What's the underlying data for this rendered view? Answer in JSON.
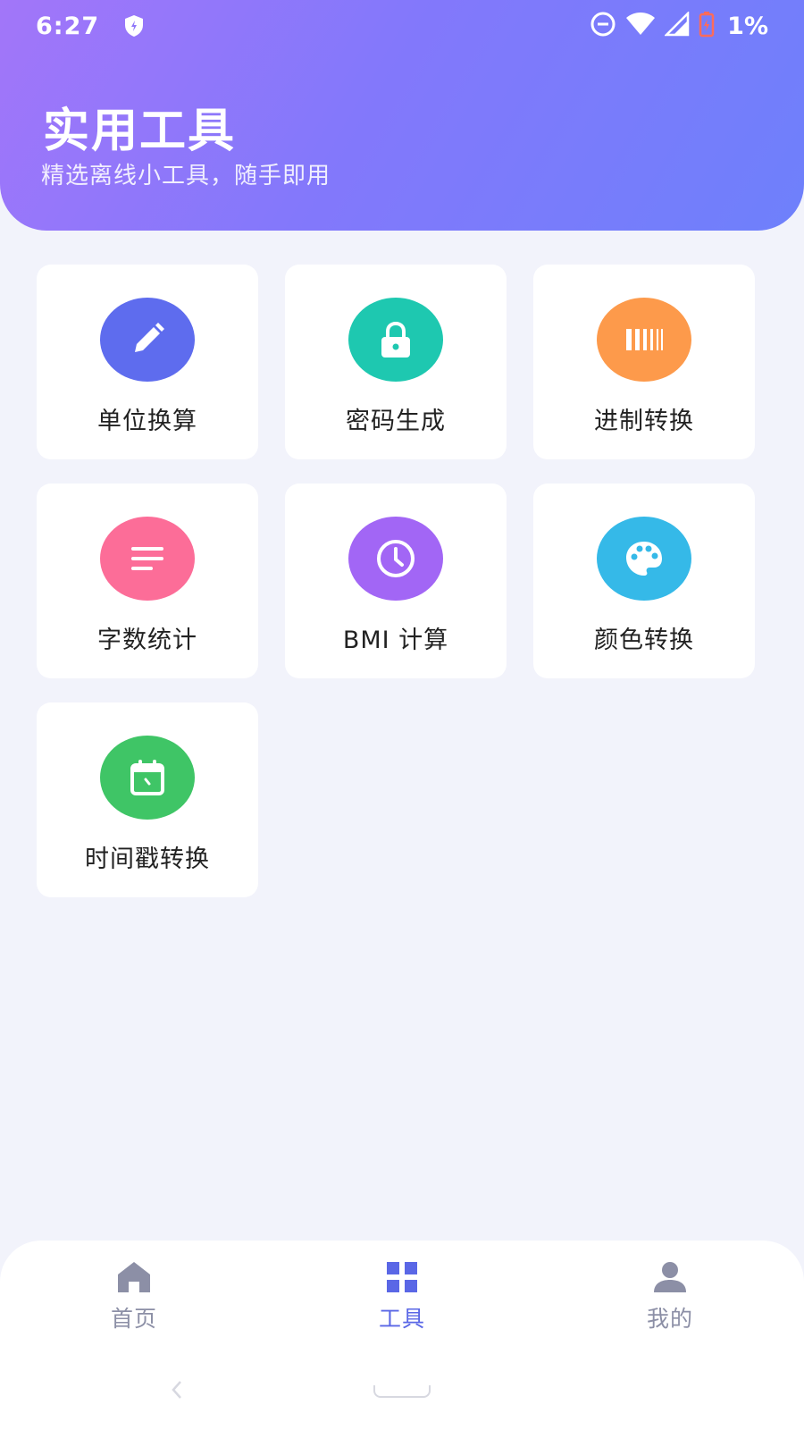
{
  "status_bar": {
    "time": "6:27",
    "battery": "1%",
    "icons": [
      "shield-icon",
      "dnd-icon",
      "wifi-icon",
      "signal-icon",
      "battery-icon"
    ]
  },
  "header": {
    "title": "实用工具",
    "subtitle": "精选离线小工具，随手即用",
    "gradient": [
      "#a276f9",
      "#6e80fb"
    ]
  },
  "tools": [
    {
      "label": "单位换算",
      "icon": "pencil-icon",
      "color": "#5e6cee"
    },
    {
      "label": "密码生成",
      "icon": "lock-icon",
      "color": "#1ec8b0"
    },
    {
      "label": "进制转换",
      "icon": "barcode-icon",
      "color": "#fd9a4b"
    },
    {
      "label": "字数统计",
      "icon": "text-lines-icon",
      "color": "#fc6d98"
    },
    {
      "label": "BMI 计算",
      "icon": "clock-icon",
      "color": "#a266f5"
    },
    {
      "label": "颜色转换",
      "icon": "palette-icon",
      "color": "#35b9e8"
    },
    {
      "label": "时间戳转换",
      "icon": "calendar-icon",
      "color": "#3fc566"
    }
  ],
  "bottom_nav": {
    "items": [
      {
        "label": "首页",
        "icon": "home-icon"
      },
      {
        "label": "工具",
        "icon": "grid-icon",
        "active": true
      },
      {
        "label": "我的",
        "icon": "person-icon"
      }
    ],
    "inactive_color": "#8c8fa6",
    "active_color": "#5a67e6"
  }
}
